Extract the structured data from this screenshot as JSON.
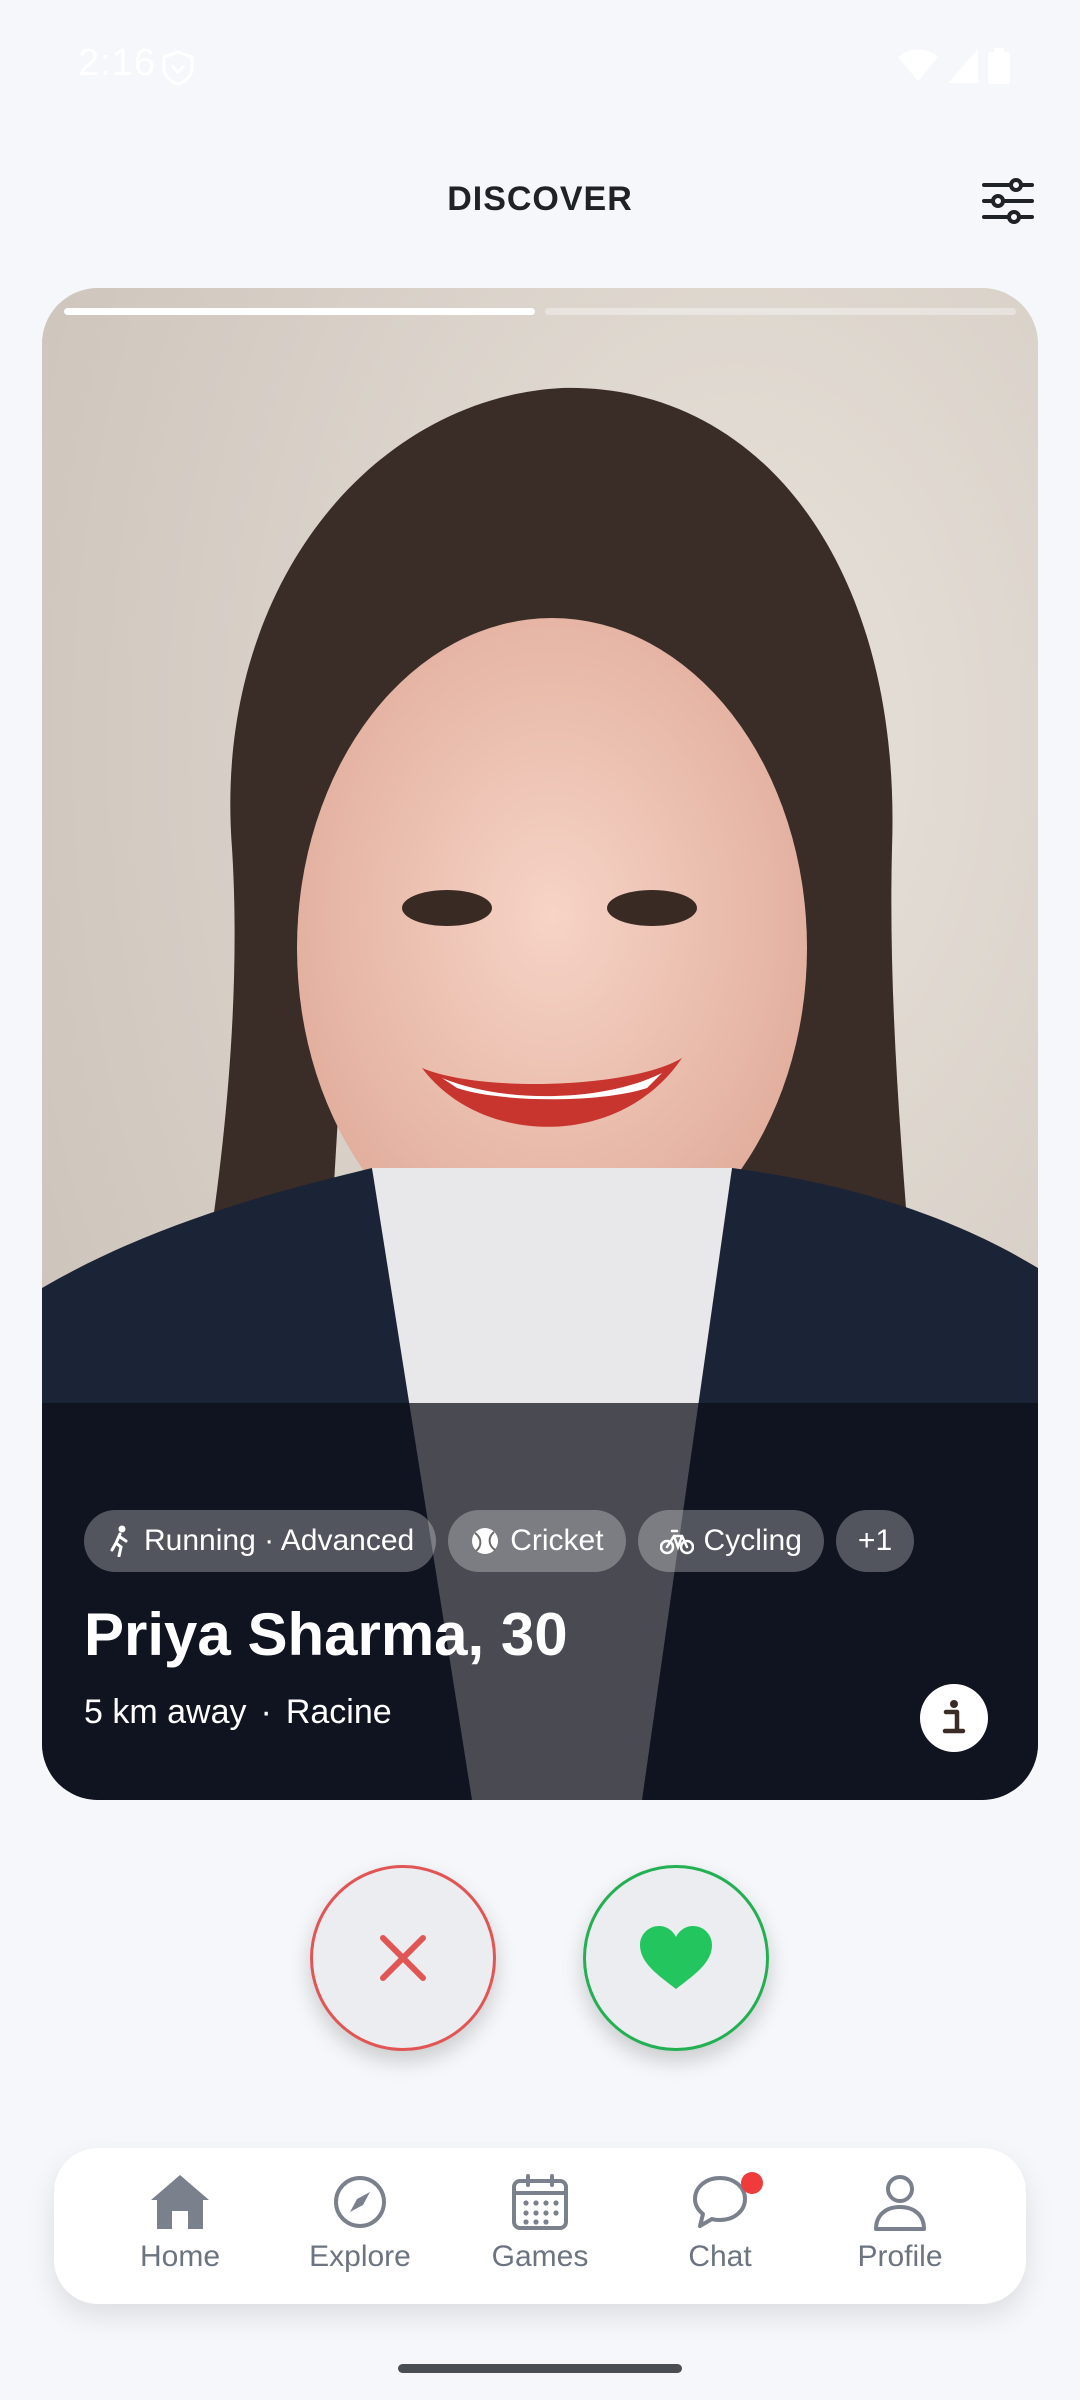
{
  "status_bar": {
    "time": "2:16"
  },
  "header": {
    "title": "DISCOVER"
  },
  "profile": {
    "name_age": "Priya Sharma, 30",
    "distance": "5 km away",
    "separator": "·",
    "location": "Racine",
    "tags": [
      {
        "label": "Running · Advanced",
        "icon": "running-icon"
      },
      {
        "label": "Cricket",
        "icon": "ball-icon"
      },
      {
        "label": "Cycling",
        "icon": "bicycle-icon"
      },
      {
        "label": "+1",
        "icon": ""
      }
    ],
    "photo_progress": {
      "total": 2,
      "current": 1
    }
  },
  "actions": {
    "pass_icon": "close-icon",
    "like_icon": "heart-icon"
  },
  "nav": {
    "items": [
      {
        "label": "Home",
        "icon": "home-icon"
      },
      {
        "label": "Explore",
        "icon": "compass-icon"
      },
      {
        "label": "Games",
        "icon": "calendar-icon"
      },
      {
        "label": "Chat",
        "icon": "chat-icon",
        "has_badge": true
      },
      {
        "label": "Profile",
        "icon": "person-icon"
      }
    ]
  },
  "colors": {
    "pass": "#e25555",
    "like": "#22b052",
    "badge": "#ef3b3b",
    "background": "#f5f7fa"
  }
}
